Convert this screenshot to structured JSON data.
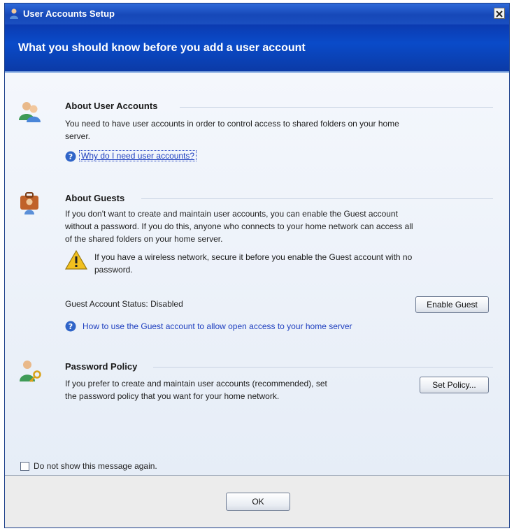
{
  "window": {
    "title": "User Accounts Setup",
    "header": "What you should know before you add a user account"
  },
  "sections": {
    "accounts": {
      "heading": "About User Accounts",
      "text_lines": [
        "You need to have user accounts in order to control access to shared folders on your home",
        "server."
      ],
      "link": "Why do I need user accounts?"
    },
    "guests": {
      "heading": "About Guests",
      "text_lines": [
        "If you don't want to create and maintain user accounts, you can enable the Guest account",
        "without a password. If you do this, anyone who connects to your home network can access all",
        "of the shared folders on your home server."
      ],
      "warning_lines": [
        "If you have a wireless network, secure it before you enable the Guest account with no",
        "password."
      ],
      "status": "Guest Account Status: Disabled",
      "enable_button": "Enable Guest",
      "link": "How to use the Guest account to allow open access to your home server"
    },
    "password": {
      "heading": "Password Policy",
      "text_lines": [
        "If you prefer to create and maintain user accounts (recommended), set",
        "the password policy that you want for your home network."
      ],
      "button": "Set Policy..."
    }
  },
  "footer": {
    "checkbox_label": "Do not show this message again.",
    "checkbox_checked": false,
    "ok_button": "OK"
  },
  "icons": {
    "title": "user-accounts-icon",
    "close": "close-icon",
    "accounts": "users-icon",
    "guests": "guest-icon",
    "warning": "warning-icon",
    "help": "help-icon",
    "password": "user-key-icon"
  },
  "colors": {
    "title_bar": "#1648b8",
    "header_band": "#0a4bc9",
    "link": "#1e3fbf",
    "warning": "#f2c01e"
  }
}
